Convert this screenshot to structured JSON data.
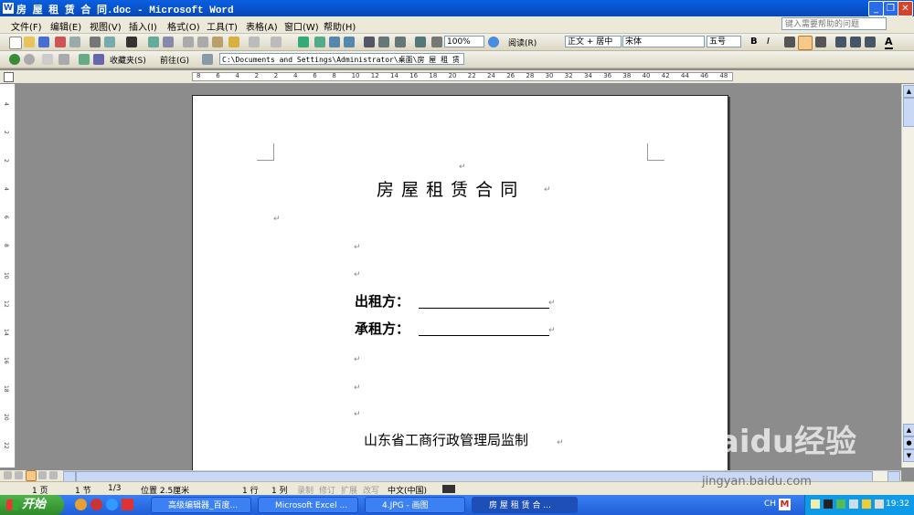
{
  "window": {
    "title": "房 屋 租 赁 合 同.doc - Microsoft Word"
  },
  "menu": {
    "items": [
      "文件(F)",
      "编辑(E)",
      "视图(V)",
      "插入(I)",
      "格式(O)",
      "工具(T)",
      "表格(A)",
      "窗口(W)",
      "帮助(H)"
    ],
    "help_placeholder": "键入需要帮助的问题"
  },
  "toolbar": {
    "zoom": "100%",
    "read_label": "阅读(R)",
    "style": "正文 + 居中",
    "font": "宋体",
    "font_size": "五号",
    "bold": "B",
    "italic": "I",
    "font_color": "A"
  },
  "webbar": {
    "favorites": "收藏夹(S)",
    "goto": "前往(G)",
    "address": "C:\\Documents and Settings\\Administrator\\桌面\\房 屋 租 赁"
  },
  "ruler": {
    "h_numbers": [
      "8",
      "6",
      "4",
      "2",
      "2",
      "4",
      "6",
      "8",
      "10",
      "12",
      "14",
      "16",
      "18",
      "20",
      "22",
      "24",
      "26",
      "28",
      "30",
      "32",
      "34",
      "36",
      "38",
      "40",
      "42",
      "44",
      "46",
      "48"
    ]
  },
  "document": {
    "title": "房 屋 租 赁 合 同",
    "lessor_label": "出租方：",
    "lessee_label": "承租方：",
    "supervisor": "山东省工商行政管理局监制",
    "para_mark": "↵"
  },
  "status": {
    "page": "1 页",
    "section": "1 节",
    "pages": "1/3",
    "position": "位置 2.5厘米",
    "line": "1 行",
    "column": "1 列",
    "rec": "录制",
    "trk": "修订",
    "ext": "扩展",
    "ovr": "改写",
    "language": "中文(中国)"
  },
  "taskbar": {
    "start": "开始",
    "tasks": [
      "高级编辑器_百度...",
      "Microsoft Excel ...",
      "4.JPG - 画图",
      "房 屋 租 赁 合 ..."
    ],
    "lang": "CH",
    "clock": "19:32"
  },
  "watermark": {
    "text": "Baidu经验",
    "url": "jingyan.baidu.com"
  },
  "colors": {
    "title_bar": "#0A5FE0",
    "start_button": "#3F9E3A",
    "page_bg": "#FFFFFF",
    "workspace": "#8C8C8C"
  }
}
